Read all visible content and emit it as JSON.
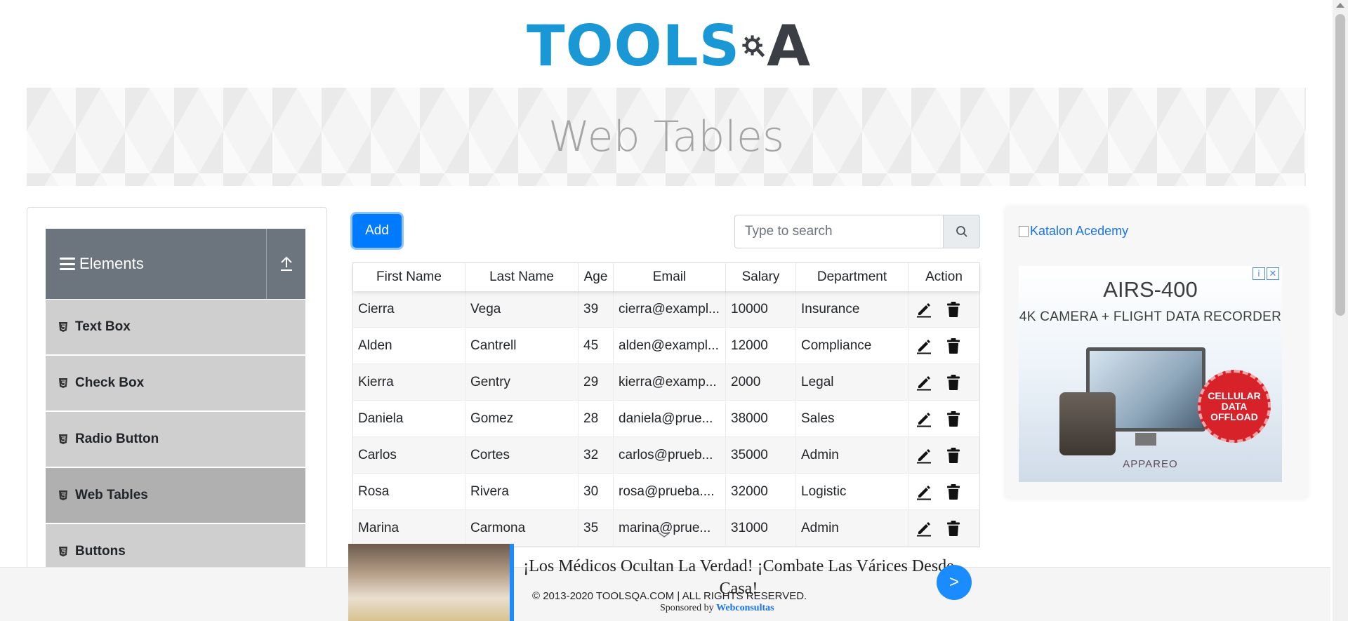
{
  "logo": {
    "tools": "TOOLS",
    "a": "A",
    "colors": {
      "tools": "#1a97d5",
      "qa": "#3b3e44"
    }
  },
  "banner": {
    "title": "Web Tables"
  },
  "sidebar": {
    "group_title": "Elements",
    "items": [
      {
        "label": "Text Box",
        "active": false
      },
      {
        "label": "Check Box",
        "active": false
      },
      {
        "label": "Radio Button",
        "active": false
      },
      {
        "label": "Web Tables",
        "active": true
      },
      {
        "label": "Buttons",
        "active": false
      }
    ]
  },
  "toolbar": {
    "add_label": "Add",
    "search_placeholder": "Type to search"
  },
  "table": {
    "headers": [
      "First Name",
      "Last Name",
      "Age",
      "Email",
      "Salary",
      "Department",
      "Action"
    ],
    "rows": [
      [
        "Cierra",
        "Vega",
        "39",
        "cierra@exampl...",
        "10000",
        "Insurance"
      ],
      [
        "Alden",
        "Cantrell",
        "45",
        "alden@exampl...",
        "12000",
        "Compliance"
      ],
      [
        "Kierra",
        "Gentry",
        "29",
        "kierra@examp...",
        "2000",
        "Legal"
      ],
      [
        "Daniela",
        "Gomez",
        "28",
        "daniela@prue...",
        "38000",
        "Sales"
      ],
      [
        "Carlos",
        "Cortes",
        "32",
        "carlos@prueb...",
        "35000",
        "Admin"
      ],
      [
        "Rosa",
        "Rivera",
        "30",
        "rosa@prueba....",
        "32000",
        "Logistic"
      ],
      [
        "Marina",
        "Carmona",
        "35",
        "marina@prue...",
        "31000",
        "Admin"
      ]
    ]
  },
  "right_ad": {
    "link_text": "Katalon Acedemy",
    "title": "AIRS-400",
    "subtitle": "4K CAMERA + FLIGHT DATA RECORDER",
    "badge": "CELLULAR DATA OFFLOAD",
    "brand": "APPAREO"
  },
  "footer": {
    "copyright": "© 2013-2020 TOOLSQA.COM | ALL RIGHTS RESERVED."
  },
  "bottom_ad": {
    "title": "¡Los Médicos Ocultan La Verdad! ¡Combate Las Várices Desde Casa!",
    "sponsored_prefix": "Sponsored by",
    "sponsor": "Webconsultas",
    "go_label": ">"
  },
  "colors": {
    "primary": "#007bff",
    "sidebar_header": "#6c757d",
    "menu_item": "#cfcfcf",
    "menu_active": "#b0b0b0"
  }
}
